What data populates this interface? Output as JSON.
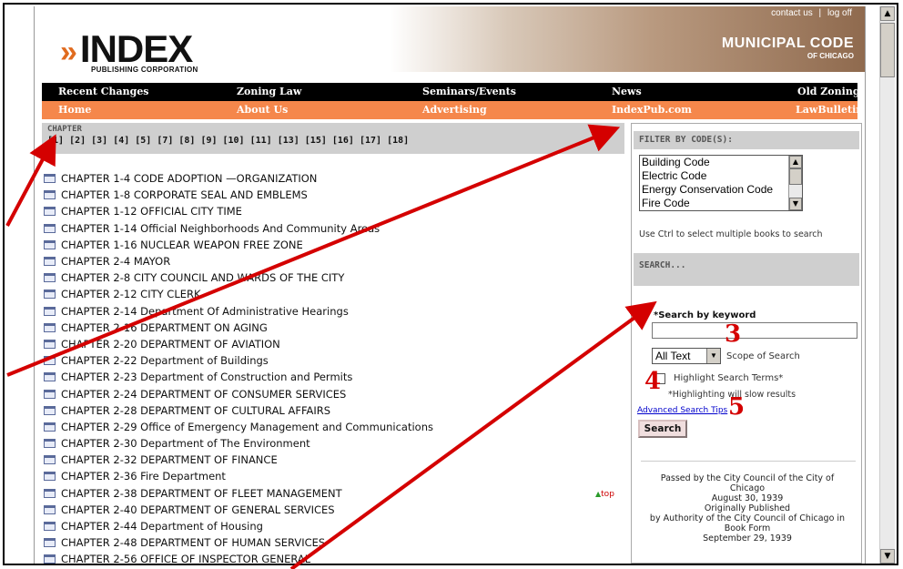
{
  "header": {
    "logo_text": "INDEX",
    "logo_sub": "PUBLISHING CORPORATION",
    "top_links": [
      "contact us",
      "|",
      "log off"
    ],
    "banner_title": "MUNICIPAL CODE",
    "banner_subtitle": "OF CHICAGO"
  },
  "nav_primary": [
    "Recent Changes",
    "Zoning Law",
    "Seminars/Events",
    "News",
    "Old Zoning"
  ],
  "nav_secondary": [
    "Home",
    "About Us",
    "Advertising",
    "IndexPub.com",
    "LawBulletin"
  ],
  "chapter_bar": {
    "title": "CHAPTER",
    "numbers": [
      "[1]",
      "[2]",
      "[3]",
      "[4]",
      "[5]",
      "[7]",
      "[8]",
      "[9]",
      "[10]",
      "[11]",
      "[13]",
      "[15]",
      "[16]",
      "[17]",
      "[18]"
    ]
  },
  "chapters": [
    "CHAPTER 1-4 CODE ADOPTION —ORGANIZATION",
    "CHAPTER 1-8 CORPORATE SEAL AND EMBLEMS",
    "CHAPTER 1-12 OFFICIAL CITY TIME",
    "CHAPTER 1-14 Official Neighborhoods And Community Areas",
    "CHAPTER 1-16 NUCLEAR WEAPON FREE ZONE",
    "CHAPTER 2-4 MAYOR",
    "CHAPTER 2-8 CITY COUNCIL AND WARDS OF THE CITY",
    "CHAPTER 2-12 CITY CLERK",
    "CHAPTER 2-14 Department Of Administrative Hearings",
    "CHAPTER 2-16 DEPARTMENT ON AGING",
    "CHAPTER 2-20 DEPARTMENT OF AVIATION",
    "CHAPTER 2-22 Department of Buildings",
    "CHAPTER 2-23 Department of Construction and Permits",
    "CHAPTER 2-24 DEPARTMENT OF CONSUMER SERVICES",
    "CHAPTER 2-28 DEPARTMENT OF CULTURAL AFFAIRS",
    "CHAPTER 2-29 Office of Emergency Management and Communications",
    "CHAPTER 2-30 Department of The Environment",
    "CHAPTER 2-32 DEPARTMENT OF FINANCE",
    "CHAPTER 2-36 Fire Department",
    "CHAPTER 2-38 DEPARTMENT OF FLEET MANAGEMENT",
    "CHAPTER 2-40 DEPARTMENT OF GENERAL SERVICES",
    "CHAPTER 2-44 Department of Housing",
    "CHAPTER 2-48 DEPARTMENT OF HUMAN SERVICES",
    "CHAPTER 2-56 OFFICE OF INSPECTOR GENERAL"
  ],
  "top_link": "top",
  "filter": {
    "heading": "FILTER BY CODE(S):",
    "options": [
      "Building Code",
      "Electric Code",
      "Energy Conservation Code",
      "Fire Code"
    ],
    "note": "Use Ctrl to select multiple books to search"
  },
  "search": {
    "heading": "SEARCH...",
    "keyword_label": "*Search by keyword",
    "keyword_value": "",
    "scope_value": "All Text",
    "scope_label": "Scope of Search",
    "highlight_label": "Highlight Search Terms*",
    "highlight_note": "*Highlighting will slow results",
    "advanced_tips": "Advanced Search Tips",
    "button": "Search"
  },
  "passed_text": [
    "Passed by the City Council of the City of",
    "Chicago",
    "August 30, 1939",
    "Originally Published",
    "by Authority of the City Council of Chicago in",
    "Book Form",
    "September 29, 1939"
  ],
  "annotations": [
    "3",
    "4",
    "5"
  ],
  "colors": {
    "nav_primary": "#000000",
    "nav_secondary": "#f5874b",
    "annotation": "#d40000",
    "link": "#0000cc"
  }
}
